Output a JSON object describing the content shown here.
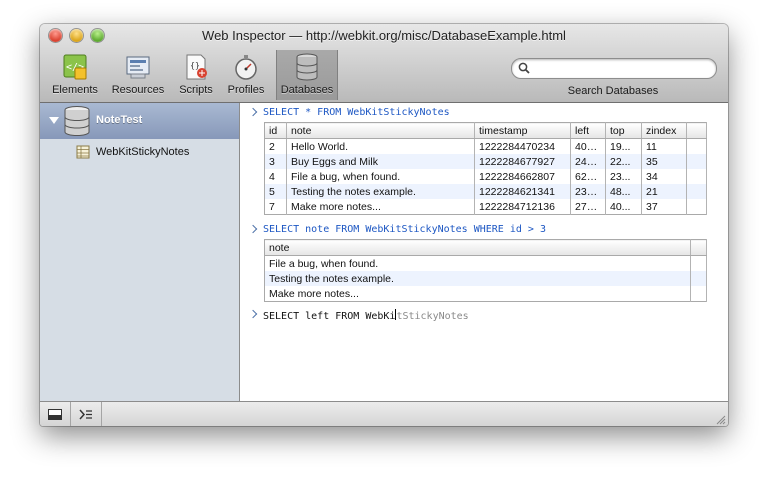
{
  "window": {
    "title": "Web Inspector — http://webkit.org/misc/DatabaseExample.html"
  },
  "toolbar": {
    "items": [
      {
        "label": "Elements",
        "icon": "elements-icon"
      },
      {
        "label": "Resources",
        "icon": "resources-icon"
      },
      {
        "label": "Scripts",
        "icon": "scripts-icon"
      },
      {
        "label": "Profiles",
        "icon": "profiles-icon"
      },
      {
        "label": "Databases",
        "icon": "databases-icon",
        "selected": true
      }
    ],
    "search": {
      "label": "Search Databases",
      "placeholder": "",
      "value": ""
    }
  },
  "sidebar": {
    "database": {
      "name": "NoteTest",
      "expanded": true
    },
    "tables": [
      {
        "name": "WebKitStickyNotes"
      }
    ]
  },
  "console": {
    "queries": [
      {
        "command": "SELECT * FROM WebKitStickyNotes",
        "columns": [
          "id",
          "note",
          "timestamp",
          "left",
          "top",
          "zindex"
        ],
        "rows": [
          [
            "2",
            "Hello World.",
            "1222284470234",
            "408...",
            "19...",
            "11"
          ],
          [
            "3",
            "Buy Eggs and Milk",
            "1222284677927",
            "240...",
            "22...",
            "35"
          ],
          [
            "4",
            "File a bug, when found.",
            "1222284662807",
            "626...",
            "23...",
            "34"
          ],
          [
            "5",
            "Testing the notes example.",
            "1222284621341",
            "231...",
            "48...",
            "21"
          ],
          [
            "7",
            "Make more notes...",
            "1222284712136",
            "278...",
            "40...",
            "37"
          ]
        ]
      },
      {
        "command": "SELECT note FROM WebKitStickyNotes WHERE id > 3",
        "columns": [
          "note"
        ],
        "rows": [
          [
            "File a bug, when found."
          ],
          [
            "Testing the notes example."
          ],
          [
            "Make more notes..."
          ]
        ]
      }
    ],
    "input": {
      "typed": "SELECT left FROM WebKi",
      "completion": "tStickyNotes"
    }
  },
  "statusbar": {
    "buttons": [
      {
        "icon": "dock-icon"
      },
      {
        "icon": "console-icon"
      }
    ]
  }
}
